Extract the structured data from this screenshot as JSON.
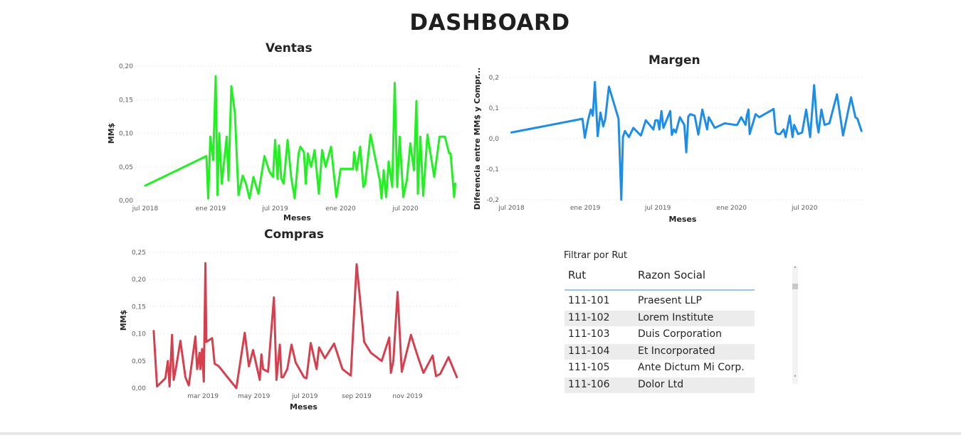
{
  "dashboard_title": "DASHBOARD",
  "chart_data": [
    {
      "id": "ventas",
      "type": "line",
      "title": "Ventas",
      "xlabel": "Meses",
      "ylabel": "MM$",
      "color": "#21f021",
      "xlim": [
        "2018-06-07",
        "2020-11-25"
      ],
      "ylim": [
        0,
        0.2
      ],
      "yticks": [
        0,
        0.05,
        0.1,
        0.15,
        0.2
      ],
      "ytick_labels": [
        "0,00",
        "0,05",
        "0,10",
        "0,15",
        "0,20"
      ],
      "xticks": [
        "2018-07-01",
        "2019-01-01",
        "2019-07-01",
        "2020-01-01",
        "2020-07-01"
      ],
      "xtick_labels": [
        "jul 2018",
        "ene 2019",
        "jul 2019",
        "ene 2020",
        "jul 2020"
      ],
      "x": [
        "2018-07-01",
        "2018-12-20",
        "2018-12-25",
        "2018-12-31",
        "2019-01-08",
        "2019-01-15",
        "2019-01-20",
        "2019-01-25",
        "2019-02-01",
        "2019-02-08",
        "2019-02-15",
        "2019-02-20",
        "2019-02-28",
        "2019-03-10",
        "2019-03-20",
        "2019-04-01",
        "2019-04-10",
        "2019-04-20",
        "2019-05-01",
        "2019-05-15",
        "2019-06-01",
        "2019-06-15",
        "2019-06-25",
        "2019-07-01",
        "2019-07-08",
        "2019-07-12",
        "2019-07-18",
        "2019-07-25",
        "2019-08-05",
        "2019-08-15",
        "2019-08-25",
        "2019-09-05",
        "2019-09-10",
        "2019-09-20",
        "2019-09-25",
        "2019-10-01",
        "2019-10-10",
        "2019-10-20",
        "2019-11-01",
        "2019-11-10",
        "2019-11-20",
        "2019-12-05",
        "2019-12-20",
        "2020-01-01",
        "2020-01-15",
        "2020-01-25",
        "2020-02-05",
        "2020-02-08",
        "2020-02-15",
        "2020-02-25",
        "2020-03-05",
        "2020-03-10",
        "2020-03-25",
        "2020-04-20",
        "2020-04-25",
        "2020-05-01",
        "2020-05-08",
        "2020-05-15",
        "2020-05-25",
        "2020-06-01",
        "2020-06-08",
        "2020-06-15",
        "2020-06-25",
        "2020-07-05",
        "2020-07-15",
        "2020-07-25",
        "2020-08-01",
        "2020-08-05",
        "2020-08-12",
        "2020-08-20",
        "2020-09-01",
        "2020-09-20",
        "2020-10-05",
        "2020-10-20",
        "2020-11-01",
        "2020-11-05",
        "2020-11-15",
        "2020-11-18"
      ],
      "values": [
        0.022,
        0.066,
        0.003,
        0.095,
        0.06,
        0.185,
        0.008,
        0.1,
        0.025,
        0.06,
        0.095,
        0.03,
        0.17,
        0.13,
        0.008,
        0.037,
        0.025,
        0.003,
        0.035,
        0.01,
        0.066,
        0.043,
        0.035,
        0.09,
        0.032,
        0.082,
        0.033,
        0.025,
        0.09,
        0.035,
        0.003,
        0.07,
        0.08,
        0.072,
        0.025,
        0.07,
        0.05,
        0.075,
        0.01,
        0.075,
        0.05,
        0.08,
        0.005,
        0.047,
        0.047,
        0.047,
        0.047,
        0.072,
        0.045,
        0.08,
        0.02,
        0.025,
        0.098,
        0.03,
        0.003,
        0.045,
        0.005,
        0.058,
        0.02,
        0.175,
        0.02,
        0.095,
        0.005,
        0.03,
        0.085,
        0.045,
        0.148,
        0.01,
        0.095,
        0.007,
        0.098,
        0.035,
        0.095,
        0.095,
        0.07,
        0.07,
        0.005,
        0.025
      ]
    },
    {
      "id": "margen",
      "type": "line",
      "title": "Margen",
      "xlabel": "Meses",
      "ylabel": "Diferencia entre MM$ y Compr...",
      "color": "#1e8de8",
      "xlim": [
        "2018-06-07",
        "2020-11-25"
      ],
      "ylim": [
        -0.2,
        0.2
      ],
      "yticks": [
        -0.2,
        -0.1,
        0,
        0.1,
        0.2
      ],
      "ytick_labels": [
        "-0,2",
        "-0,1",
        "0,0",
        "0,1",
        "0,2"
      ],
      "xticks": [
        "2018-07-01",
        "2019-01-01",
        "2019-07-01",
        "2020-01-01",
        "2020-07-01"
      ],
      "xtick_labels": [
        "jul 2018",
        "ene 2019",
        "jul 2019",
        "ene 2020",
        "jul 2020"
      ],
      "x": [
        "2018-07-01",
        "2018-12-25",
        "2018-12-31",
        "2019-01-08",
        "2019-01-15",
        "2019-01-20",
        "2019-01-25",
        "2019-02-01",
        "2019-02-08",
        "2019-02-15",
        "2019-02-20",
        "2019-03-01",
        "2019-03-25",
        "2019-04-01",
        "2019-04-05",
        "2019-04-10",
        "2019-04-20",
        "2019-05-01",
        "2019-05-20",
        "2019-06-01",
        "2019-06-20",
        "2019-06-25",
        "2019-07-01",
        "2019-07-05",
        "2019-07-10",
        "2019-07-15",
        "2019-08-01",
        "2019-08-05",
        "2019-08-10",
        "2019-08-15",
        "2019-08-25",
        "2019-09-05",
        "2019-09-10",
        "2019-09-15",
        "2019-09-20",
        "2019-10-01",
        "2019-10-10",
        "2019-10-20",
        "2019-11-01",
        "2019-11-05",
        "2019-11-20",
        "2019-12-15",
        "2020-01-10",
        "2020-01-15",
        "2020-01-25",
        "2020-02-05",
        "2020-02-08",
        "2020-02-12",
        "2020-02-15",
        "2020-03-01",
        "2020-03-10",
        "2020-04-15",
        "2020-04-20",
        "2020-04-25",
        "2020-05-01",
        "2020-05-10",
        "2020-05-15",
        "2020-05-25",
        "2020-06-01",
        "2020-06-05",
        "2020-06-15",
        "2020-06-25",
        "2020-07-05",
        "2020-07-15",
        "2020-07-25",
        "2020-08-01",
        "2020-08-05",
        "2020-08-12",
        "2020-08-20",
        "2020-09-01",
        "2020-09-20",
        "2020-10-05",
        "2020-10-25",
        "2020-11-05",
        "2020-11-10",
        "2020-11-20"
      ],
      "values": [
        0.02,
        0.065,
        0.003,
        0.06,
        0.095,
        0.075,
        0.185,
        0.008,
        0.085,
        0.04,
        0.065,
        0.17,
        0.065,
        -0.2,
        0.005,
        0.025,
        0.005,
        0.035,
        0.01,
        0.06,
        0.03,
        0.06,
        0.06,
        0.03,
        0.09,
        0.035,
        0.09,
        0.012,
        0.03,
        0.02,
        0.07,
        0.045,
        -0.045,
        0.072,
        0.08,
        0.075,
        0.013,
        0.095,
        0.03,
        0.07,
        0.035,
        0.05,
        0.045,
        0.045,
        0.07,
        0.045,
        0.075,
        0.095,
        0.015,
        0.08,
        0.07,
        0.097,
        0.02,
        0.015,
        0.015,
        0.03,
        0.005,
        0.075,
        0.005,
        0.045,
        0.015,
        0.02,
        0.095,
        0.005,
        0.175,
        0.05,
        0.02,
        0.095,
        0.045,
        0.05,
        0.145,
        0.01,
        0.135,
        0.07,
        0.065,
        0.025
      ]
    },
    {
      "id": "compras",
      "type": "line",
      "title": "Compras",
      "xlabel": "Meses",
      "ylabel": "MM$",
      "color": "#d6404e",
      "xlim": [
        "2018-12-27",
        "2019-12-31"
      ],
      "ylim": [
        0,
        0.25
      ],
      "yticks": [
        0,
        0.05,
        0.1,
        0.15,
        0.2,
        0.25
      ],
      "ytick_labels": [
        "0,00",
        "0,05",
        "0,10",
        "0,15",
        "0,20",
        "0,25"
      ],
      "xticks": [
        "2019-03-01",
        "2019-05-01",
        "2019-07-01",
        "2019-09-01",
        "2019-11-01"
      ],
      "xtick_labels": [
        "mar 2019",
        "may 2019",
        "jul 2019",
        "sep 2019",
        "nov 2019"
      ],
      "x": [
        "2019-01-01",
        "2019-01-05",
        "2019-01-15",
        "2019-01-18",
        "2019-01-20",
        "2019-01-23",
        "2019-01-25",
        "2019-01-28",
        "2019-02-02",
        "2019-02-08",
        "2019-02-12",
        "2019-02-20",
        "2019-02-22",
        "2019-02-25",
        "2019-02-26",
        "2019-02-28",
        "2019-03-02",
        "2019-03-04",
        "2019-03-05",
        "2019-03-08",
        "2019-03-12",
        "2019-03-15",
        "2019-03-20",
        "2019-04-10",
        "2019-04-20",
        "2019-04-25",
        "2019-04-30",
        "2019-05-08",
        "2019-05-10",
        "2019-05-12",
        "2019-05-18",
        "2019-05-25",
        "2019-05-28",
        "2019-06-01",
        "2019-06-03",
        "2019-06-05",
        "2019-06-10",
        "2019-06-15",
        "2019-06-20",
        "2019-06-30",
        "2019-07-03",
        "2019-07-08",
        "2019-07-10",
        "2019-07-15",
        "2019-07-18",
        "2019-07-25",
        "2019-08-05",
        "2019-08-15",
        "2019-08-25",
        "2019-09-01",
        "2019-09-10",
        "2019-09-18",
        "2019-10-01",
        "2019-10-10",
        "2019-10-12",
        "2019-10-15",
        "2019-10-20",
        "2019-10-25",
        "2019-11-05",
        "2019-11-10",
        "2019-11-15",
        "2019-11-20",
        "2019-12-01",
        "2019-12-05",
        "2019-12-10",
        "2019-12-20",
        "2019-12-30"
      ],
      "values": [
        0.105,
        0.003,
        0.018,
        0.05,
        0.003,
        0.098,
        0.015,
        0.04,
        0.087,
        0.02,
        0.005,
        0.095,
        0.035,
        0.065,
        0.035,
        0.072,
        0.012,
        0.23,
        0.085,
        0.088,
        0.092,
        0.045,
        0.04,
        0.0,
        0.102,
        0.04,
        0.07,
        0.015,
        0.062,
        0.035,
        0.03,
        0.167,
        0.015,
        0.08,
        0.02,
        0.02,
        0.035,
        0.08,
        0.047,
        0.02,
        0.018,
        0.083,
        0.07,
        0.035,
        0.075,
        0.055,
        0.082,
        0.035,
        0.023,
        0.228,
        0.085,
        0.065,
        0.05,
        0.093,
        0.028,
        0.05,
        0.177,
        0.03,
        0.098,
        0.073,
        0.05,
        0.028,
        0.06,
        0.022,
        0.026,
        0.057,
        0.02
      ]
    }
  ],
  "slicer": {
    "title": "Filtrar por Rut",
    "headers": [
      "Rut",
      "Razon Social"
    ],
    "rows": [
      {
        "rut": "111-101",
        "razon": "Praesent LLP"
      },
      {
        "rut": "111-102",
        "razon": "Lorem Institute"
      },
      {
        "rut": "111-103",
        "razon": "Duis Corporation"
      },
      {
        "rut": "111-104",
        "razon": "Et Incorporated"
      },
      {
        "rut": "111-105",
        "razon": "Ante Dictum Mi Corp."
      },
      {
        "rut": "111-106",
        "razon": "Dolor Ltd"
      }
    ],
    "scroll_up_icon": "chevron-up-icon",
    "scroll_down_icon": "chevron-down-icon"
  }
}
